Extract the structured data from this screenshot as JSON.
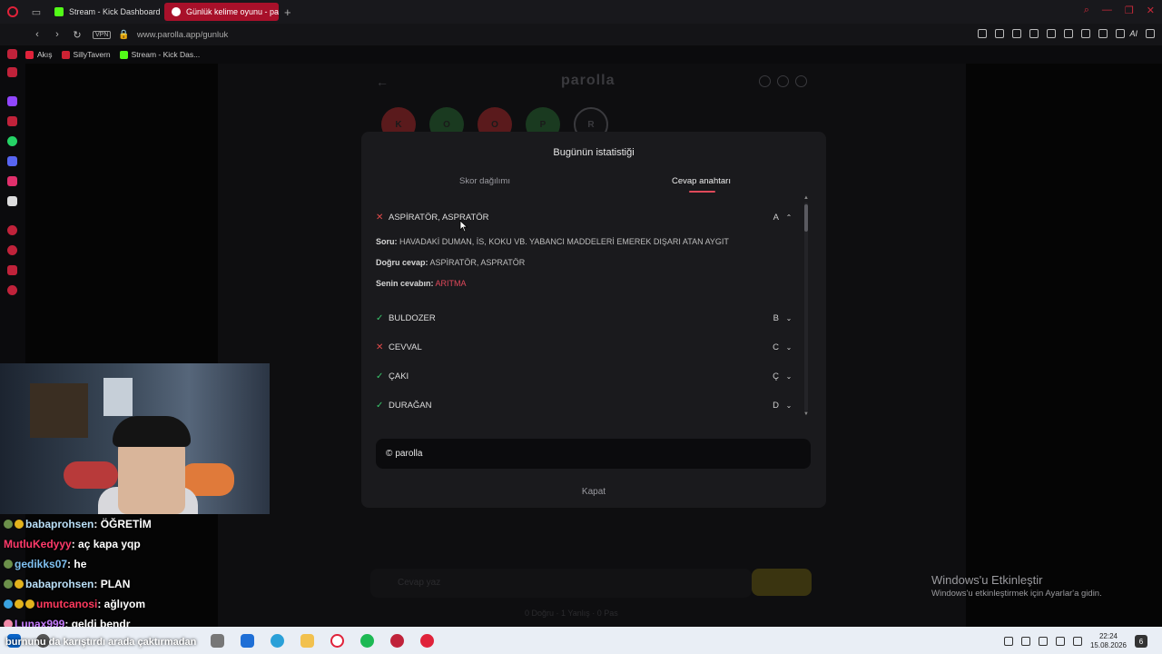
{
  "browser": {
    "tabs": [
      {
        "label": "Stream - Kick Dashboard"
      },
      {
        "label": "Günlük kelime oyunu - parolla"
      }
    ],
    "vpn_label": "VPN",
    "url": "www.parolla.app/gunluk",
    "ai_label": "AI",
    "bookmarks": [
      {
        "label": "Akış",
        "color": "#e0223a"
      },
      {
        "label": "SillyTavern",
        "color": "#cc2233"
      },
      {
        "label": "Stream - Kick Das...",
        "color": "#53fc18"
      }
    ]
  },
  "page": {
    "title": "parolla",
    "letter_circles": [
      {
        "letter": "K",
        "color": "#5a1a1c"
      },
      {
        "letter": "O",
        "color": "#1a3a20"
      },
      {
        "letter": "O",
        "color": "#5a1a1c"
      },
      {
        "letter": "P",
        "color": "#1a3a20"
      },
      {
        "letter": "R",
        "color": "#111113"
      }
    ],
    "input_placeholder": "Cevap yaz",
    "stats_text": "0 Doğru · 1 Yanlış · 0 Pas"
  },
  "modal": {
    "title": "Bugünün istatistiği",
    "tab_score": "Skor dağılımı",
    "tab_answers": "Cevap anahtarı",
    "expanded": {
      "word": "ASPİRATÖR, ASPRATÖR",
      "letter": "A",
      "status": "wrong",
      "question_label": "Soru:",
      "question": "HAVADAKİ DUMAN, İS, KOKU VB. YABANCI MADDELERİ EMEREK DIŞARI ATAN AYGIT",
      "correct_label": "Doğru cevap:",
      "correct": "ASPİRATÖR, ASPRATÖR",
      "yours_label": "Senin cevabın:",
      "yours": "ARITMA"
    },
    "rows": [
      {
        "word": "BULDOZER",
        "letter": "B",
        "status": "correct"
      },
      {
        "word": "CEVVAL",
        "letter": "C",
        "status": "wrong"
      },
      {
        "word": "ÇAKI",
        "letter": "Ç",
        "status": "correct"
      },
      {
        "word": "DURAĞAN",
        "letter": "D",
        "status": "correct"
      }
    ],
    "brand": "parolla",
    "brand_icon": "©",
    "close_label": "Kapat",
    "colors": {
      "accent": "#e04a5a",
      "correct": "#38c46a",
      "wrong": "#e24a4a"
    }
  },
  "chat": [
    {
      "user": "babaprohsen",
      "message": ": ÖĞRETİM",
      "badges": [
        "green",
        "gold"
      ],
      "user_class": "u1"
    },
    {
      "user": "MutluKedyyy",
      "message": ": aç kapa yqp",
      "badges": [],
      "user_class": "u2"
    },
    {
      "user": "gedikks07",
      "message": ": he",
      "badges": [
        "green"
      ],
      "user_class": "u3"
    },
    {
      "user": "babaprohsen",
      "message": ": PLAN",
      "badges": [
        "green",
        "gold"
      ],
      "user_class": "u1"
    },
    {
      "user": "umutcanosi",
      "message": ": ağlıyom",
      "badges": [
        "blue",
        "gold",
        "gold"
      ],
      "user_class": "u4"
    },
    {
      "user": "Lunax999",
      "message": ": geldi bendr",
      "badges": [
        "pink"
      ],
      "user_class": "u5"
    }
  ],
  "overlay_text": "burnunu da karıştırdı arada çaktırmadan",
  "windows": {
    "activate_title": "Windows'u Etkinleştir",
    "activate_sub": "Windows'u etkinleştirmek için Ayarlar'a gidin.",
    "time": "22:24",
    "date": "15.08.2026",
    "notif_count": "6"
  }
}
